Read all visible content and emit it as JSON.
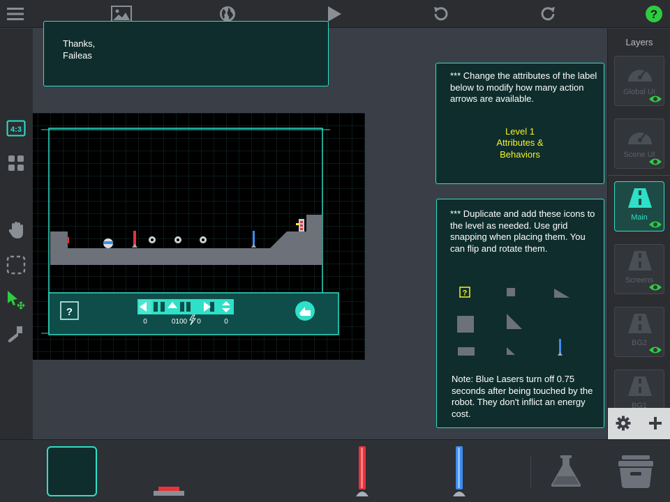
{
  "notes": {
    "top_note": [
      "Thanks,",
      "Faileas"
    ],
    "attributes_note": "*** Change the attributes of the label below to modify how many action arrows are available.",
    "level_label": [
      "Level 1",
      "Attributes &",
      "Behaviors"
    ],
    "icons_note": "*** Duplicate and add these icons to the level as needed. Use  grid snapping when placing them.  You can flip and rotate them.",
    "blue_laser_note": "Note: Blue Lasers turn off 0.75 seconds after being touched by the robot.  They don't inflict an energy cost."
  },
  "toolbar": {
    "aspect_badge": "4:3",
    "help_label": "?"
  },
  "level_hud": {
    "help_label": "?",
    "counter_left": "0",
    "counter_middle": "0100",
    "counter_energy": "0",
    "counter_right": "0"
  },
  "palette": {
    "question_label": "?"
  },
  "layers": {
    "title": "Layers",
    "items": [
      {
        "name": "Global UI"
      },
      {
        "name": "Scene UI"
      },
      {
        "name": "Main"
      },
      {
        "name": "Screens"
      },
      {
        "name": "BG2"
      },
      {
        "name": "BG1"
      }
    ]
  },
  "colors": {
    "accent": "#2ee0c8",
    "panel_bg": "#0f2d2d",
    "label_yellow": "#f5f51f",
    "help_green": "#2ecc40",
    "red_laser": "#e8323a",
    "blue_laser": "#3c8cf0"
  }
}
